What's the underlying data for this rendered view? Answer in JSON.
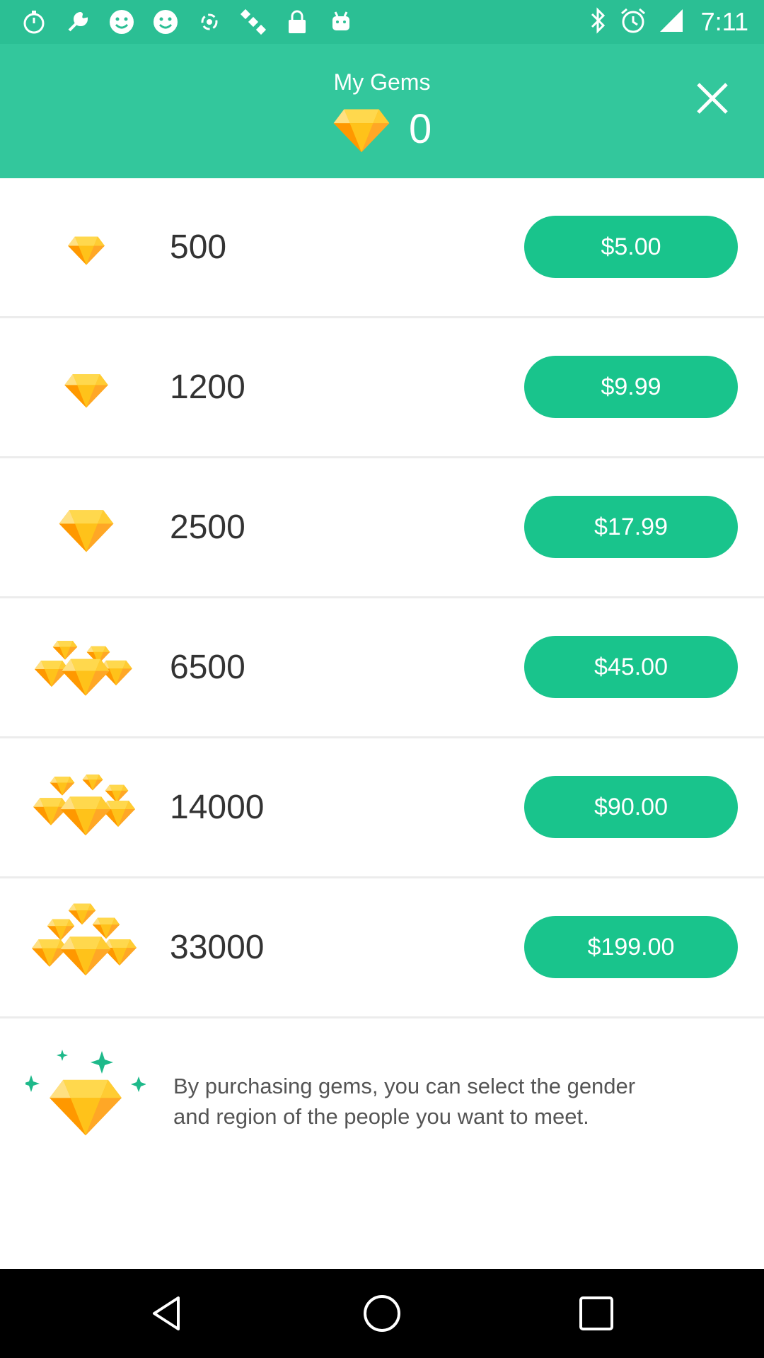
{
  "status_bar": {
    "time": "7:11",
    "left_icons": [
      "stopwatch-icon",
      "wrench-icon",
      "smiley-icon",
      "smiley-icon",
      "radio-icon",
      "satellite-icon",
      "lock-icon",
      "android-icon"
    ],
    "right_icons": [
      "bluetooth-icon",
      "alarm-icon",
      "signal-icon"
    ]
  },
  "header": {
    "title": "My Gems",
    "gem_count": "0",
    "close_icon": "close-icon"
  },
  "packages": [
    {
      "amount": "500",
      "price": "$5.00",
      "icon": "single-gem-icon"
    },
    {
      "amount": "1200",
      "price": "$9.99",
      "icon": "single-gem-icon"
    },
    {
      "amount": "2500",
      "price": "$17.99",
      "icon": "single-gem-icon"
    },
    {
      "amount": "6500",
      "price": "$45.00",
      "icon": "gem-pile-icon"
    },
    {
      "amount": "14000",
      "price": "$90.00",
      "icon": "gem-pile-icon"
    },
    {
      "amount": "33000",
      "price": "$199.00",
      "icon": "gem-pile-icon"
    }
  ],
  "info": {
    "text_line1": "By purchasing gems, you can select the gender",
    "text_line2": "and region of the people you want to meet."
  },
  "colors": {
    "header_bg": "#33c79c",
    "button_bg": "#19c48c",
    "gem_gold": "#ffc21a"
  },
  "nav": [
    "back-icon",
    "home-icon",
    "recents-icon"
  ]
}
